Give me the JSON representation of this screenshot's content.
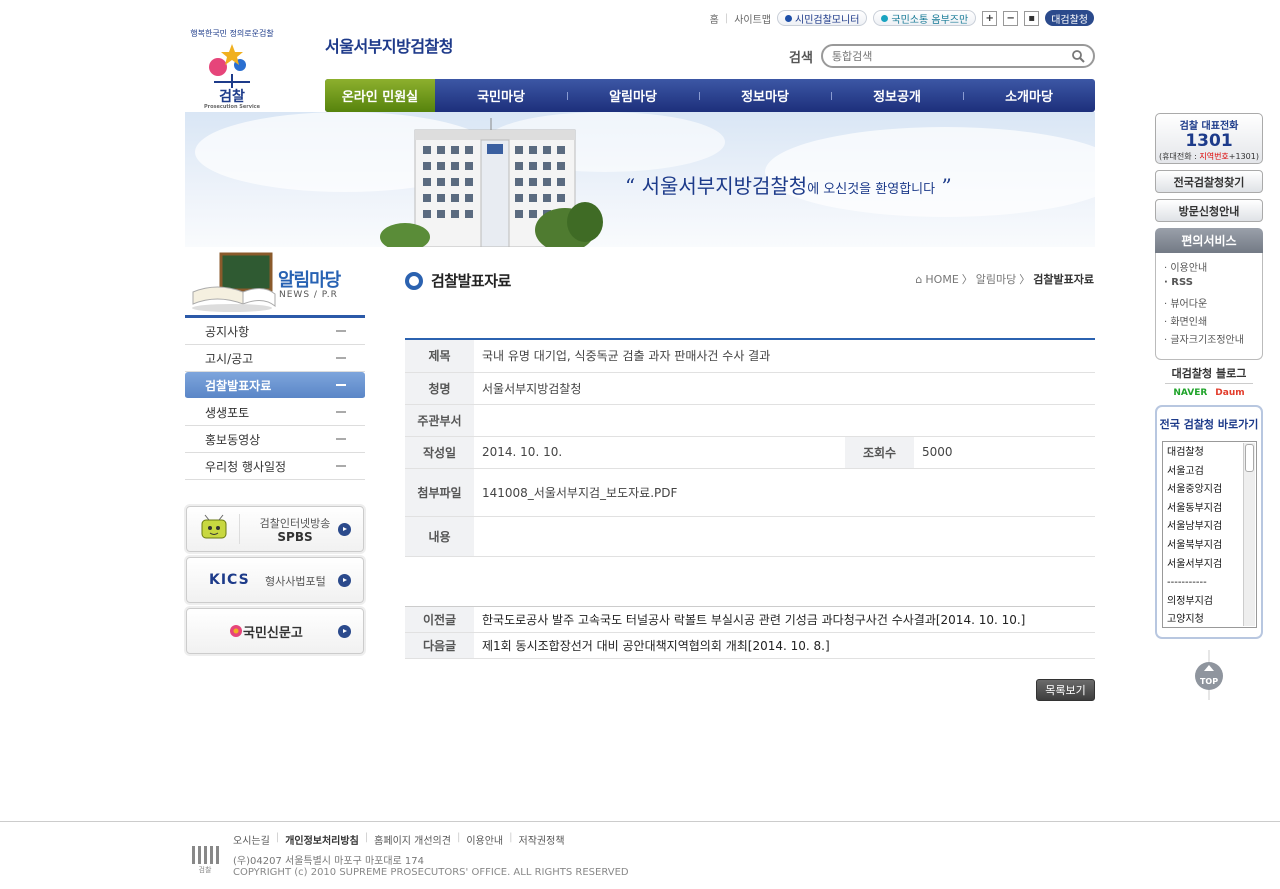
{
  "header": {
    "logo_arc_text": "행복한국민 정의로운검찰",
    "logo_text": "검찰",
    "logo_sub": "Prosecution Service",
    "site_name": "서울서부지방검찰청",
    "util": {
      "home": "홈",
      "sitemap": "사이트맵",
      "monitor": "시민검찰모니터",
      "voc": "국민소통 옴부즈만",
      "font_plus": "+",
      "font_minus": "−",
      "font_reset": "▪",
      "spo": "대검찰청"
    },
    "search": {
      "label": "검색",
      "placeholder": "통합검색"
    }
  },
  "gnb": [
    "온라인 민원실",
    "국민마당",
    "알림마당",
    "정보마당",
    "정보공개",
    "소개마당"
  ],
  "banner": {
    "open_quote": "“",
    "org": "서울서부지방검찰청",
    "welcome": "에 오신것을 환영합니다",
    "close_quote": "”"
  },
  "lnb": {
    "title": "알림마당",
    "sub": "NEWS / P.R",
    "items": [
      "공지사항",
      "고시/공고",
      "검찰발표자료",
      "생생포토",
      "홍보동영상",
      "우리청 행사일정"
    ],
    "active_index": 2
  },
  "side_banners": {
    "spbs_title": "검찰인터넷방송",
    "spbs_name": "SPBS",
    "kics_logo": "KICS",
    "kics_name": "형사사법포털",
    "sinmungo": "국민신문고"
  },
  "content": {
    "title": "검찰발표자료",
    "breadcrumb": [
      "HOME",
      "알림마당",
      "검찰발표자료"
    ],
    "rows": {
      "subject_label": "제목",
      "subject": "국내 유명 대기업, 식중독균 검출 과자 판매사건 수사 결과",
      "office_label": "청명",
      "office": "서울서부지방검찰청",
      "dept_label": "주관부서",
      "dept": "",
      "date_label": "작성일",
      "date": "2014. 10. 10.",
      "views_label": "조회수",
      "views": "5000",
      "file_label": "첨부파일",
      "file": "141008_서울서부지검_보도자료.PDF",
      "body_label": "내용",
      "body": ""
    },
    "prev_label": "이전글",
    "prev": "한국도로공사 발주 고속국도 터널공사 락볼트 부실시공 관련 기성금 과다청구사건 수사결과[2014. 10. 10.]",
    "next_label": "다음글",
    "next": "제1회 동시조합장선거 대비 공안대책지역협의회 개최[2014. 10. 8.]",
    "list_button": "목록보기"
  },
  "quick": {
    "tel_title": "검찰 대표전화",
    "tel_number": "1301",
    "tel_note_pre": "(휴대전화 : ",
    "tel_note_red": "지역번호",
    "tel_note_post": "+1301)",
    "find": "전국검찰청찾기",
    "visit": "방문신청안내",
    "conv_title": "편의서비스",
    "conv_items": [
      "· 이용안내",
      "· RSS",
      "· 뷰어다운",
      "· 화면인쇄",
      "· 글자크기조정안내"
    ],
    "blog_title": "대검찰청 블로그",
    "naver": "NAVER",
    "daum": "Daum",
    "spo_title": "전국 검찰청 바로가기",
    "spo_options": [
      "대검찰청",
      "서울고검",
      "서울중앙지검",
      "서울동부지검",
      "서울남부지검",
      "서울북부지검",
      "서울서부지검",
      "-----------",
      "의정부지검",
      "고양지청"
    ],
    "top": "TOP"
  },
  "footer": {
    "logo_text": "검찰",
    "links": [
      "오시는길",
      "개인정보처리방침",
      "홈페이지 개선의견",
      "이용안내",
      "저작권정책"
    ],
    "address": "(우)04207 서울특별시 마포구 마포대로 174",
    "copyright": "COPYRIGHT (c) 2010 SUPREME PROSECUTORS' OFFICE. ALL RIGHTS RESERVED"
  },
  "colors": {
    "brand_blue": "#1d3b8a",
    "gnb_green": "#6d9a1c",
    "accent": "#2b62b0"
  }
}
